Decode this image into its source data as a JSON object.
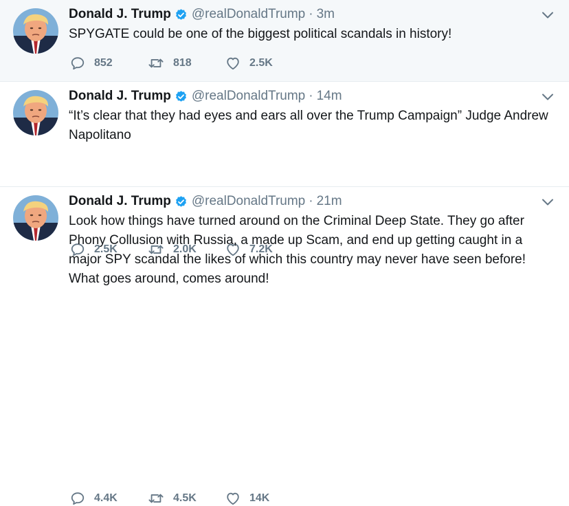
{
  "tweets": [
    {
      "author_name": "Donald J. Trump",
      "handle": "@realDonaldTrump",
      "separator": "·",
      "time": "3m",
      "text": "SPYGATE could be one of the biggest political scandals in history!",
      "replies": "852",
      "retweets": "818",
      "likes": "2.5K"
    },
    {
      "author_name": "Donald J. Trump",
      "handle": "@realDonaldTrump",
      "separator": "·",
      "time": "14m",
      "text": "“It’s clear that they had eyes and ears all over the Trump Campaign” Judge Andrew Napolitano",
      "replies": "2.5K",
      "retweets": "2.0K",
      "likes": "7.2K"
    },
    {
      "author_name": "Donald J. Trump",
      "handle": "@realDonaldTrump",
      "separator": "·",
      "time": "21m",
      "text": "Look how things have turned around on the Criminal Deep State. They go after Phony Collusion with Russia, a made up Scam, and end up getting caught in a major SPY scandal the likes of which this country may never have seen before! What goes around, comes around!",
      "replies": "4.4K",
      "retweets": "4.5K",
      "likes": "14K"
    }
  ],
  "icons": {
    "verified": "verified-badge-icon",
    "caret": "chevron-down-icon",
    "reply": "reply-bubble-icon",
    "retweet": "retweet-arrows-icon",
    "like": "heart-icon"
  },
  "colors": {
    "highlight_background": "#f5f8fa",
    "secondary_text": "#657786",
    "verified_blue": "#1da1f2",
    "divider": "#e6ecf0"
  }
}
